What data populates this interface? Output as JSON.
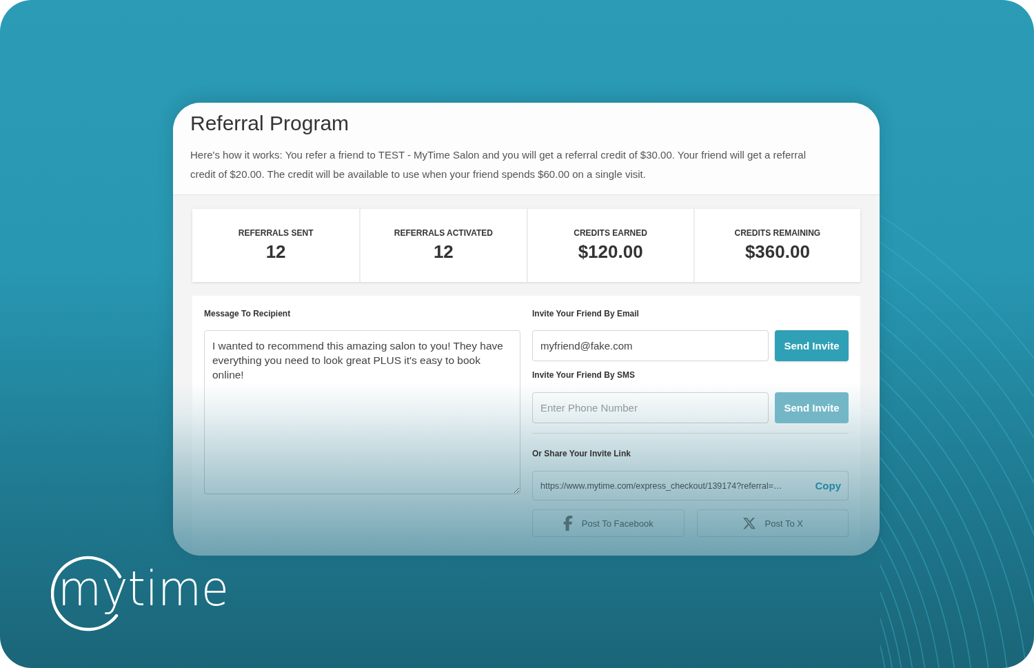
{
  "card": {
    "title": "Referral Program",
    "description": "Here's how it works: You refer a friend to TEST - MyTime Salon and you will get a referral credit of $30.00. Your friend will get a referral credit of $20.00. The credit will be available to use when your friend spends $60.00 on a single visit.",
    "stats": [
      {
        "label": "REFERRALS SENT",
        "value": "12"
      },
      {
        "label": "REFERRALS ACTIVATED",
        "value": "12"
      },
      {
        "label": "CREDITS EARNED",
        "value": "$120.00"
      },
      {
        "label": "CREDITS REMAINING",
        "value": "$360.00"
      }
    ],
    "message": {
      "label": "Message To Recipient",
      "value": "I wanted to recommend this amazing salon to you! They have everything you need to look great PLUS it's easy to book online!"
    },
    "email_invite": {
      "label": "Invite Your Friend By Email",
      "value": "myfriend@fake.com",
      "button": {
        "label": "Send Invite",
        "disabled": false
      }
    },
    "sms_invite": {
      "label": "Invite Your Friend By SMS",
      "placeholder": "Enter Phone Number",
      "button": {
        "label": "Send Invite",
        "disabled": true
      }
    },
    "share_link": {
      "label": "Or Share Your Invite Link",
      "url": "https://www.mytime.com/express_checkout/139174?referral=…",
      "copy_label": "Copy"
    },
    "social_buttons": [
      {
        "kind": "facebook",
        "label": "Post To Facebook"
      },
      {
        "kind": "x",
        "label": "Post To X"
      }
    ]
  },
  "logo": {
    "text": "mytime"
  }
}
